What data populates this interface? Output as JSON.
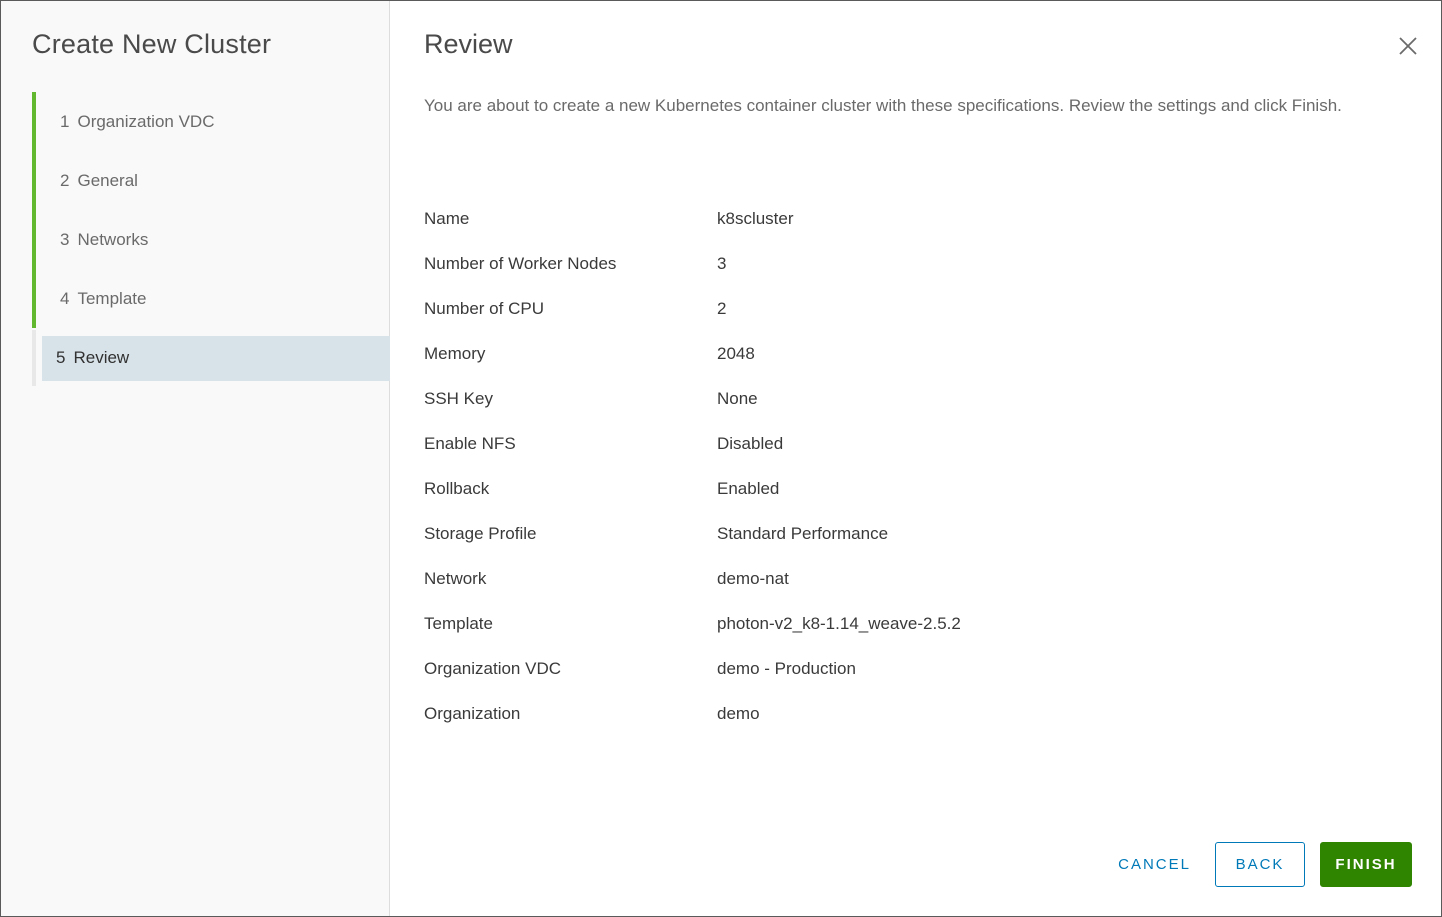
{
  "sidebar": {
    "title": "Create New Cluster",
    "steps": [
      {
        "num": "1",
        "label": "Organization VDC"
      },
      {
        "num": "2",
        "label": "General"
      },
      {
        "num": "3",
        "label": "Networks"
      },
      {
        "num": "4",
        "label": "Template"
      },
      {
        "num": "5",
        "label": "Review"
      }
    ],
    "active_step": 5
  },
  "main": {
    "title": "Review",
    "description": "You are about to create a new Kubernetes container cluster with these specifications. Review the settings and click Finish.",
    "specs": [
      {
        "label": "Name",
        "value": "k8scluster"
      },
      {
        "label": "Number of Worker Nodes",
        "value": "3"
      },
      {
        "label": "Number of CPU",
        "value": "2"
      },
      {
        "label": "Memory",
        "value": "2048"
      },
      {
        "label": "SSH Key",
        "value": "None"
      },
      {
        "label": "Enable NFS",
        "value": "Disabled"
      },
      {
        "label": "Rollback",
        "value": "Enabled"
      },
      {
        "label": "Storage Profile",
        "value": "Standard Performance"
      },
      {
        "label": "Network",
        "value": "demo-nat"
      },
      {
        "label": "Template",
        "value": "photon-v2_k8-1.14_weave-2.5.2"
      },
      {
        "label": "Organization VDC",
        "value": "demo - Production"
      },
      {
        "label": "Organization",
        "value": "demo"
      }
    ]
  },
  "footer": {
    "cancel_label": "CANCEL",
    "back_label": "BACK",
    "finish_label": "FINISH"
  },
  "icons": {
    "close": "close-icon"
  },
  "colors": {
    "completed_step_bar": "#62b92f",
    "active_step_bg": "#d8e3e9",
    "primary_blue": "#0079b8",
    "finish_green": "#2f8400"
  }
}
